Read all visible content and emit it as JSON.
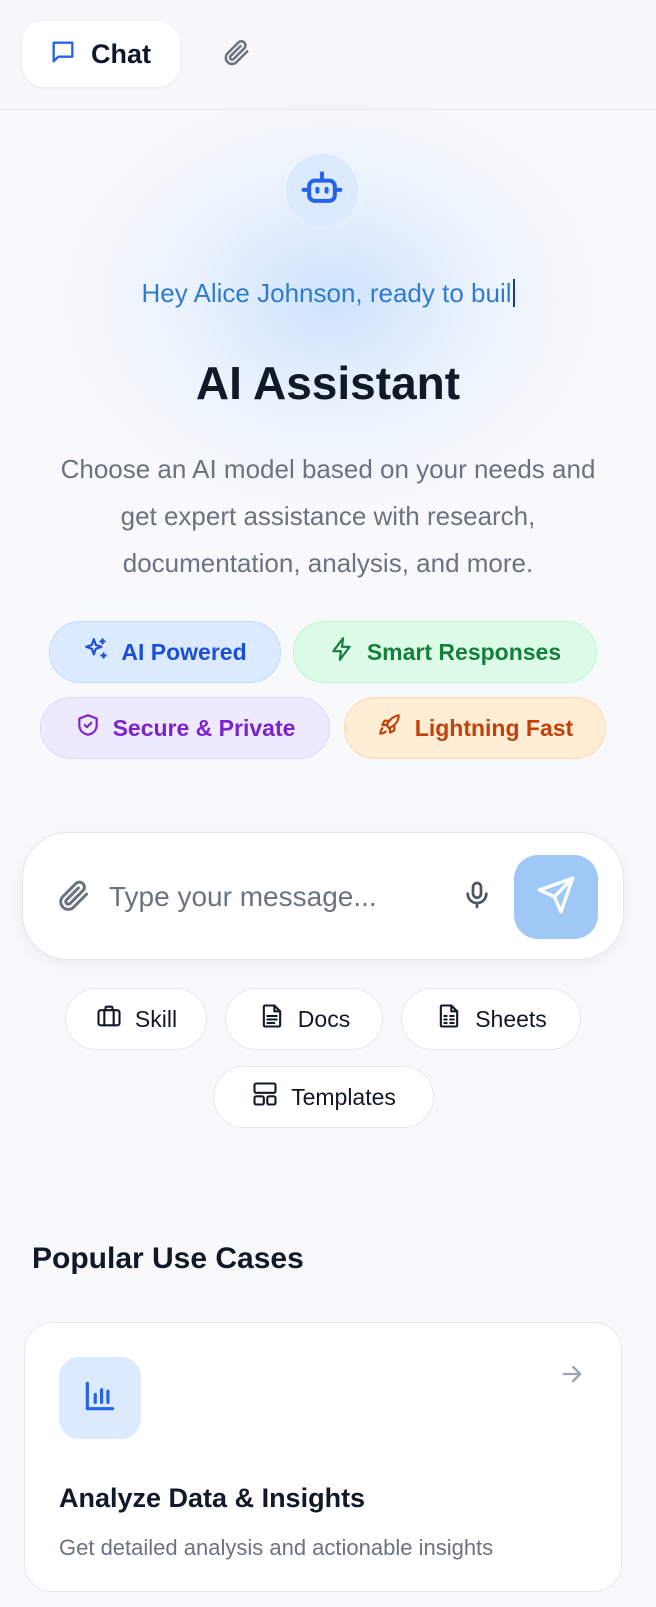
{
  "tabs": {
    "chat_label": "Chat"
  },
  "hero": {
    "typing_text": "Hey Alice Johnson, ready to buil",
    "title": "AI Assistant",
    "subtitle": "Choose an AI model based on your needs and get expert assistance with research, documentation, analysis, and more."
  },
  "features": [
    {
      "label": "AI Powered",
      "icon": "sparkles-icon",
      "color": "#1d4ed8"
    },
    {
      "label": "Smart Responses",
      "icon": "lightning-icon",
      "color": "#15803d"
    },
    {
      "label": "Secure & Private",
      "icon": "shield-icon",
      "color": "#7e22ce"
    },
    {
      "label": "Lightning Fast",
      "icon": "rocket-icon",
      "color": "#c2410c"
    }
  ],
  "composer": {
    "value": "",
    "placeholder": "Type your message..."
  },
  "tools": [
    {
      "label": "Skill",
      "icon": "briefcase-icon"
    },
    {
      "label": "Docs",
      "icon": "document-icon"
    },
    {
      "label": "Sheets",
      "icon": "spreadsheet-icon"
    },
    {
      "label": "Templates",
      "icon": "layout-icon"
    }
  ],
  "use_cases": {
    "title": "Popular Use Cases",
    "items": [
      {
        "title": "Analyze Data & Insights",
        "description": "Get detailed analysis and actionable insights",
        "icon": "bar-chart-icon"
      }
    ]
  },
  "colors": {
    "accent": "#2563eb",
    "send_button": "#9fc8f7"
  }
}
